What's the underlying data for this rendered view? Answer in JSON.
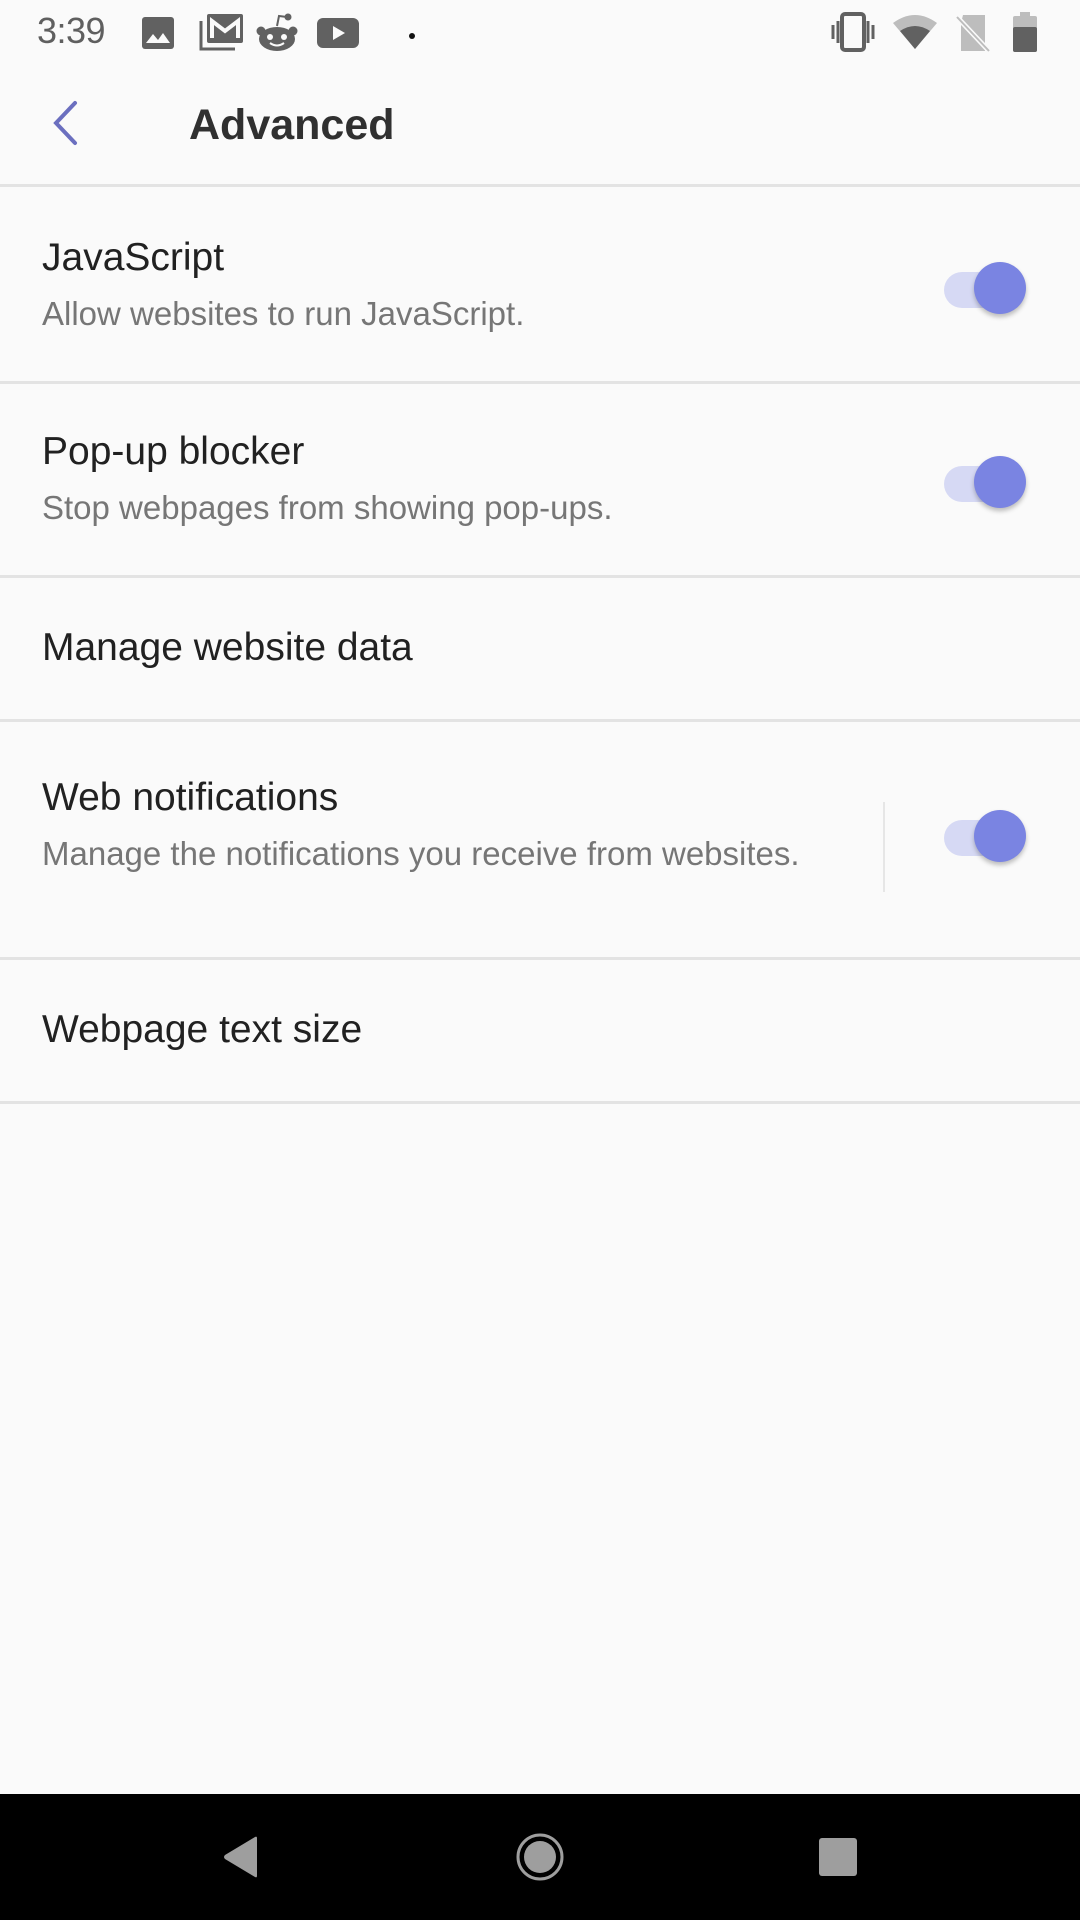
{
  "status_bar": {
    "time": "3:39",
    "left_icons": [
      "image-icon",
      "gmail-icon",
      "reddit-icon",
      "youtube-icon",
      "notification-dot-icon"
    ],
    "right_icons": [
      "vibrate-icon",
      "wifi-icon",
      "no-sim-icon",
      "battery-icon"
    ]
  },
  "app_bar": {
    "title": "Advanced",
    "back_icon": "chevron-left-icon"
  },
  "colors": {
    "accent": "#7a84e2",
    "accent_track": "#d6d9f4",
    "back_icon": "#6b6fbf",
    "title_text": "#303030",
    "primary_text": "#212121",
    "secondary_text": "#767676",
    "divider": "#e3e3e3",
    "background": "#fafafa"
  },
  "settings": [
    {
      "title": "JavaScript",
      "subtitle": "Allow websites to run JavaScript.",
      "toggle": true,
      "enabled": true
    },
    {
      "title": "Pop-up blocker",
      "subtitle": "Stop webpages from showing pop-ups.",
      "toggle": true,
      "enabled": true
    },
    {
      "title": "Manage website data"
    },
    {
      "title": "Web notifications",
      "subtitle": "Manage the notifications you receive from websites.",
      "toggle": true,
      "enabled": true
    },
    {
      "title": "Webpage text size"
    }
  ],
  "nav_bar": {
    "back": "nav-back-icon",
    "home": "nav-home-icon",
    "recents": "nav-recents-icon"
  }
}
